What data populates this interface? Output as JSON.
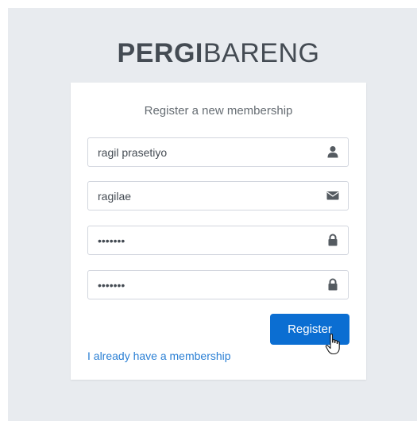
{
  "brand": {
    "bold": "PERGI",
    "light": "BARENG"
  },
  "form": {
    "title": "Register a new membership",
    "full_name": {
      "value": "ragil prasetiyo",
      "icon": "user-icon"
    },
    "email": {
      "value": "ragilae",
      "icon": "envelope-icon"
    },
    "password": {
      "value": "•••••••",
      "icon": "lock-icon"
    },
    "retype_password": {
      "value": "•••••••",
      "icon": "lock-icon"
    },
    "register_label": "Register",
    "membership_link": "I already have a membership"
  },
  "colors": {
    "background": "#e8ebef",
    "accent": "#0b6ed2",
    "link": "#2a7fd4"
  }
}
